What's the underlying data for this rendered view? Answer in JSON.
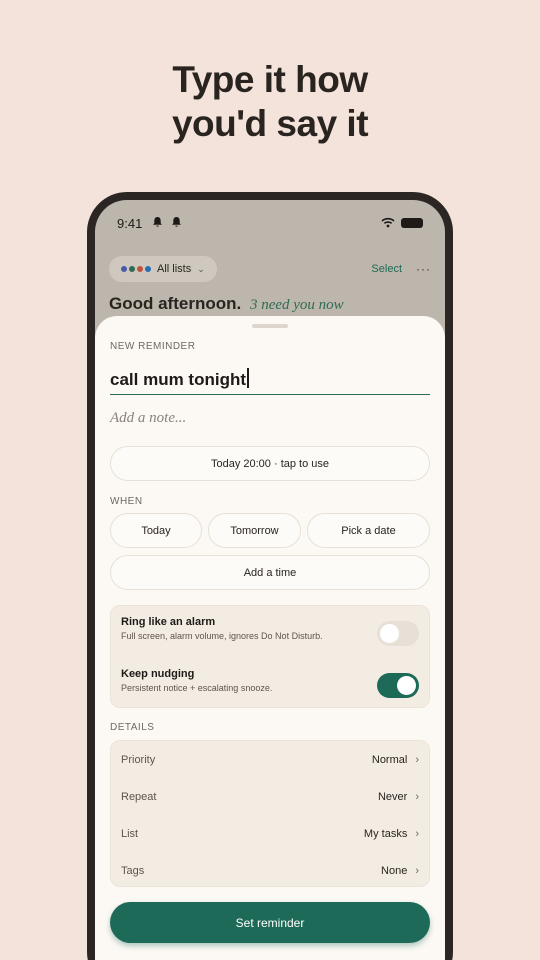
{
  "headline": {
    "line1": "Type it how",
    "line2": "you'd say it"
  },
  "status_bar": {
    "time": "9:41"
  },
  "header": {
    "list_filter": "All lists",
    "list_dot_colors": [
      "#4a5aa8",
      "#2f6b54",
      "#c2513a",
      "#2b6cb0"
    ],
    "select_label": "Select",
    "more_label": "···",
    "greeting": "Good afternoon.",
    "greeting_sub": "3 need you now"
  },
  "sheet": {
    "section_label": "NEW REMINDER",
    "title_value": "call mum tonight",
    "note_placeholder": "Add a note...",
    "suggestion": "Today 20:00 · tap to use",
    "when_label": "WHEN",
    "when_options": [
      "Today",
      "Tomorrow",
      "Pick a date"
    ],
    "add_time": "Add a time",
    "alarm": {
      "title": "Ring like an alarm",
      "subtitle": "Full screen, alarm volume, ignores Do Not Disturb.",
      "on": false
    },
    "nudge": {
      "title": "Keep nudging",
      "subtitle": "Persistent notice + escalating snooze.",
      "on": true
    },
    "details_label": "DETAILS",
    "details": [
      {
        "label": "Priority",
        "value": "Normal"
      },
      {
        "label": "Repeat",
        "value": "Never"
      },
      {
        "label": "List",
        "value": "My tasks"
      },
      {
        "label": "Tags",
        "value": "None"
      }
    ],
    "submit": "Set reminder"
  },
  "colors": {
    "accent": "#1e6a58",
    "toggle_off": "#e7e0d6"
  }
}
